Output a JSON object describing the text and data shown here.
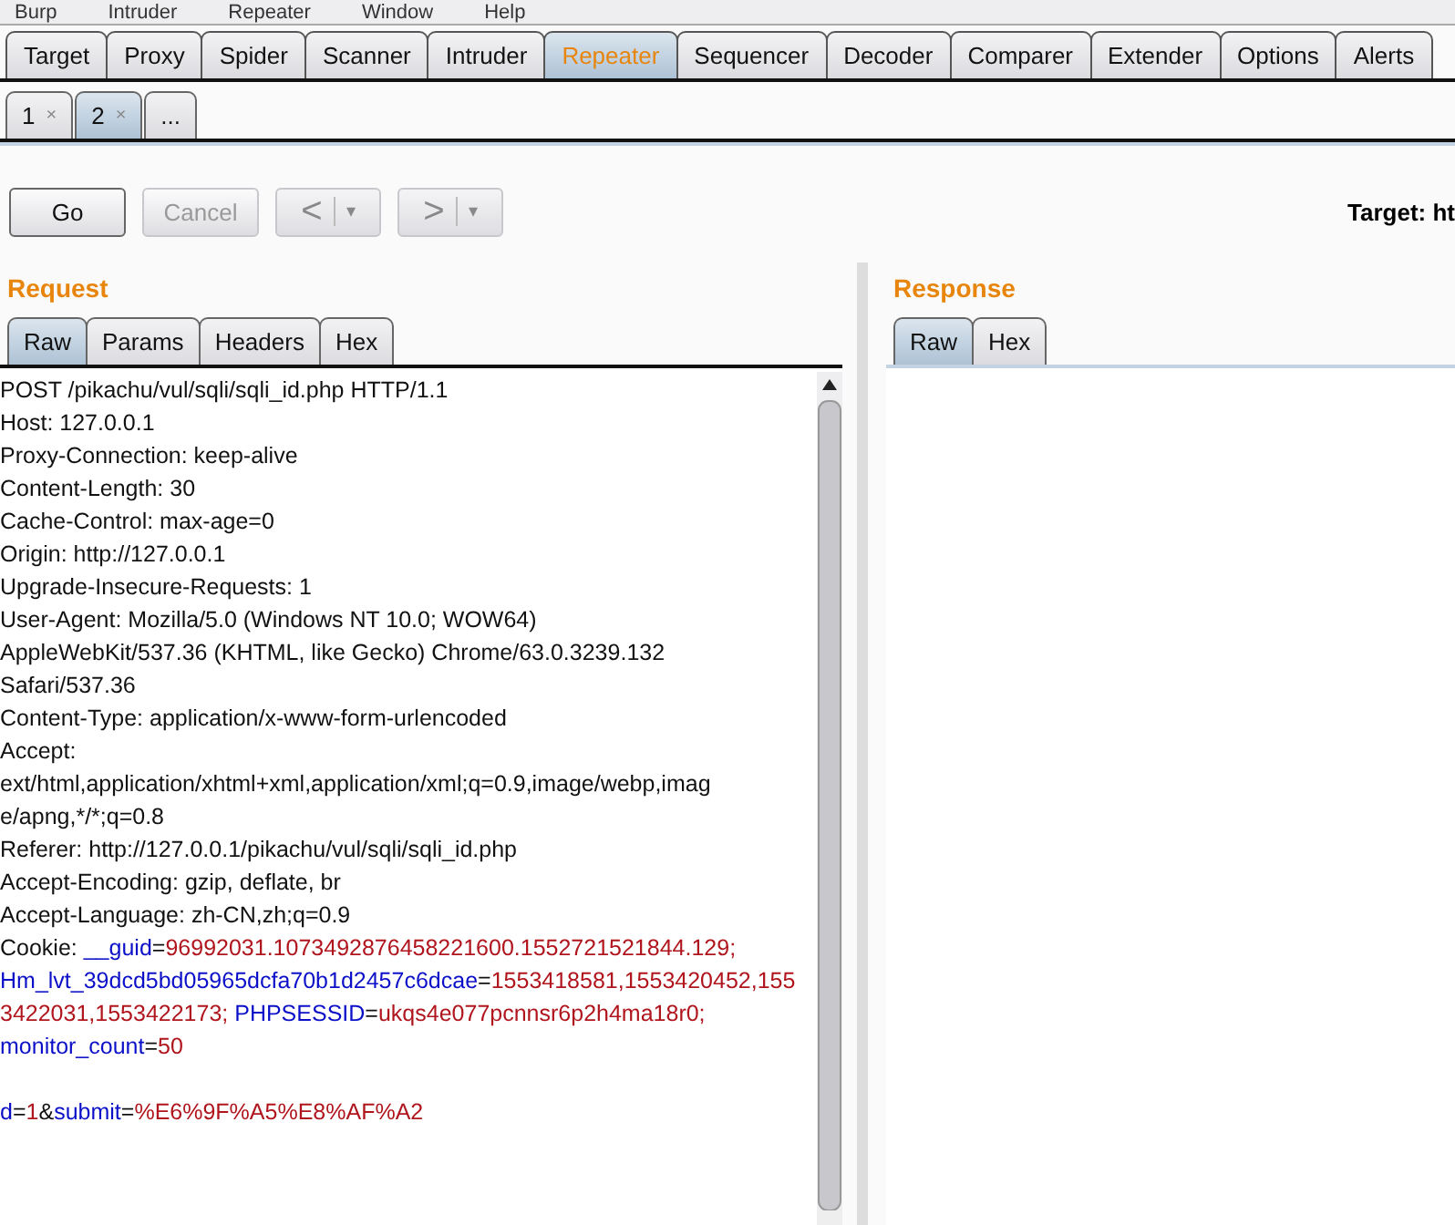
{
  "menu_bar": [
    "Burp",
    "Intruder",
    "Repeater",
    "Window",
    "Help"
  ],
  "main_tabs": [
    {
      "label": "Target",
      "selected": false
    },
    {
      "label": "Proxy",
      "selected": false
    },
    {
      "label": "Spider",
      "selected": false
    },
    {
      "label": "Scanner",
      "selected": false
    },
    {
      "label": "Intruder",
      "selected": false
    },
    {
      "label": "Repeater",
      "selected": true
    },
    {
      "label": "Sequencer",
      "selected": false
    },
    {
      "label": "Decoder",
      "selected": false
    },
    {
      "label": "Comparer",
      "selected": false
    },
    {
      "label": "Extender",
      "selected": false
    },
    {
      "label": "Options",
      "selected": false
    },
    {
      "label": "Alerts",
      "selected": false
    }
  ],
  "request_tabs": [
    {
      "label": "1",
      "close": "×",
      "selected": false
    },
    {
      "label": "2",
      "close": "×",
      "selected": true
    },
    {
      "label": "...",
      "selected": false
    }
  ],
  "buttons": [
    {
      "kind": "text",
      "label": "Go",
      "disabled": false
    },
    {
      "kind": "text",
      "label": "Cancel",
      "disabled": true
    },
    {
      "kind": "split",
      "label": "<",
      "arrow": "▾",
      "disabled": true
    },
    {
      "kind": "split",
      "label": ">",
      "arrow": "▾",
      "disabled": true
    }
  ],
  "target": "Target: ht",
  "request": {
    "title": "Request",
    "tabs": [
      {
        "label": "Raw",
        "selected": true
      },
      {
        "label": "Params",
        "selected": false
      },
      {
        "label": "Headers",
        "selected": false
      },
      {
        "label": "Hex",
        "selected": false
      }
    ],
    "lines": [
      [
        {
          "kind": "plain",
          "text": "POST /pikachu/vul/sqli/sqli_id.php HTTP/1.1"
        }
      ],
      [
        {
          "kind": "plain",
          "text": "Host: 127.0.0.1"
        }
      ],
      [
        {
          "kind": "plain",
          "text": "Proxy-Connection: keep-alive"
        }
      ],
      [
        {
          "kind": "plain",
          "text": "Content-Length: 30"
        }
      ],
      [
        {
          "kind": "plain",
          "text": "Cache-Control: max-age=0"
        }
      ],
      [
        {
          "kind": "plain",
          "text": "Origin: http://127.0.0.1"
        }
      ],
      [
        {
          "kind": "plain",
          "text": "Upgrade-Insecure-Requests: 1"
        }
      ],
      [
        {
          "kind": "plain",
          "text": "User-Agent: Mozilla/5.0 (Windows NT 10.0; WOW64)"
        }
      ],
      [
        {
          "kind": "plain",
          "text": "AppleWebKit/537.36 (KHTML, like Gecko) Chrome/63.0.3239.132"
        }
      ],
      [
        {
          "kind": "plain",
          "text": "Safari/537.36"
        }
      ],
      [
        {
          "kind": "plain",
          "text": "Content-Type: application/x-www-form-urlencoded"
        }
      ],
      [
        {
          "kind": "plain",
          "text": "Accept:"
        }
      ],
      [
        {
          "kind": "plain",
          "text": "ext/html,application/xhtml+xml,application/xml;q=0.9,image/webp,imag"
        }
      ],
      [
        {
          "kind": "plain",
          "text": "e/apng,*/*;q=0.8"
        }
      ],
      [
        {
          "kind": "plain",
          "text": "Referer: http://127.0.0.1/pikachu/vul/sqli/sqli_id.php"
        }
      ],
      [
        {
          "kind": "plain",
          "text": "Accept-Encoding: gzip, deflate, br"
        }
      ],
      [
        {
          "kind": "plain",
          "text": "Accept-Language: zh-CN,zh;q=0.9"
        }
      ],
      [
        {
          "kind": "plain",
          "text": "Cookie: "
        },
        {
          "kind": "name",
          "text": "__guid"
        },
        {
          "kind": "plain",
          "text": "="
        },
        {
          "kind": "value",
          "text": "96992031.1073492876458221600.1552721521844.129;"
        }
      ],
      [
        {
          "kind": "name",
          "text": "Hm_lvt_39dcd5bd05965dcfa70b1d2457c6dcae"
        },
        {
          "kind": "plain",
          "text": "="
        },
        {
          "kind": "value",
          "text": "1553418581,1553420452,155"
        }
      ],
      [
        {
          "kind": "value",
          "text": "3422031,1553422173; "
        },
        {
          "kind": "name",
          "text": "PHPSESSID"
        },
        {
          "kind": "plain",
          "text": "="
        },
        {
          "kind": "value",
          "text": "ukqs4e077pcnnsr6p2h4ma18r0;"
        }
      ],
      [
        {
          "kind": "name",
          "text": "monitor_count"
        },
        {
          "kind": "plain",
          "text": "="
        },
        {
          "kind": "value",
          "text": "50"
        }
      ],
      {
        "blank_before": true,
        "segments": [
          {
            "kind": "name",
            "text": "d"
          },
          {
            "kind": "plain",
            "text": "="
          },
          {
            "kind": "value",
            "text": "1"
          },
          {
            "kind": "plain",
            "text": "&"
          },
          {
            "kind": "name",
            "text": "submit"
          },
          {
            "kind": "plain",
            "text": "="
          },
          {
            "kind": "value",
            "text": "%E6%9F%A5%E8%AF%A2"
          }
        ]
      }
    ]
  },
  "response": {
    "title": "Response",
    "tabs": [
      {
        "label": "Raw",
        "selected": true
      },
      {
        "label": "Hex",
        "selected": false
      }
    ]
  }
}
